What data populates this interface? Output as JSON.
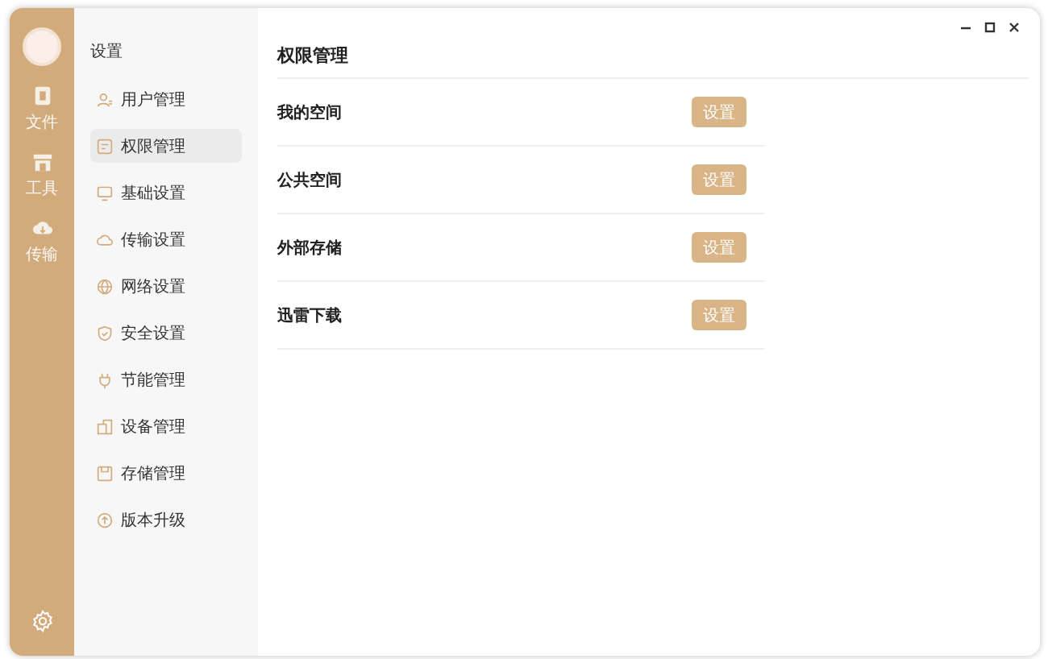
{
  "rail": {
    "items": [
      {
        "kind": "file",
        "label": "文件"
      },
      {
        "kind": "tools",
        "label": "工具"
      },
      {
        "kind": "transfer",
        "label": "传输"
      }
    ]
  },
  "nav": {
    "title": "设置",
    "items": [
      {
        "kind": "user",
        "label": "用户管理",
        "selected": false
      },
      {
        "kind": "permission",
        "label": "权限管理",
        "selected": true
      },
      {
        "kind": "monitor",
        "label": "基础设置",
        "selected": false
      },
      {
        "kind": "cloud",
        "label": "传输设置",
        "selected": false
      },
      {
        "kind": "globe",
        "label": "网络设置",
        "selected": false
      },
      {
        "kind": "shield",
        "label": "安全设置",
        "selected": false
      },
      {
        "kind": "plug",
        "label": "节能管理",
        "selected": false
      },
      {
        "kind": "device",
        "label": "设备管理",
        "selected": false
      },
      {
        "kind": "disk",
        "label": "存储管理",
        "selected": false
      },
      {
        "kind": "upgrade",
        "label": "版本升级",
        "selected": false
      }
    ]
  },
  "main": {
    "title": "权限管理",
    "rows": [
      {
        "label": "我的空间",
        "button": "设置"
      },
      {
        "label": "公共空间",
        "button": "设置"
      },
      {
        "label": "外部存储",
        "button": "设置"
      },
      {
        "label": "迅雷下载",
        "button": "设置"
      }
    ]
  }
}
